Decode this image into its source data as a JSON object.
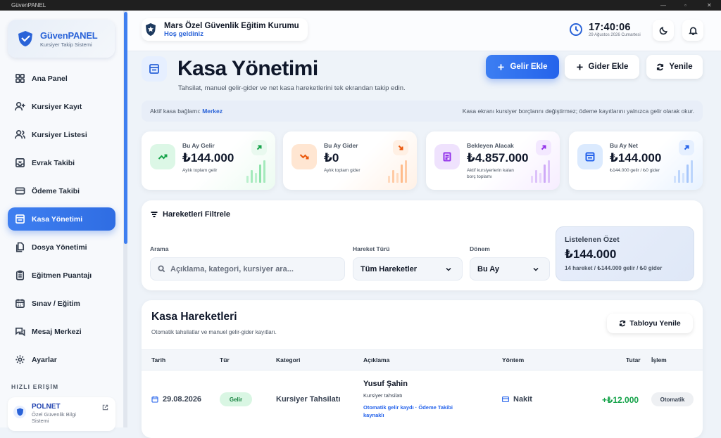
{
  "window": {
    "title": "GüvenPANEL"
  },
  "brand": {
    "name": "GüvenPANEL",
    "subtitle": "Kursiyer Takip Sistemi"
  },
  "sidebar": {
    "items": [
      {
        "label": "Ana Panel",
        "icon": "grid-icon"
      },
      {
        "label": "Kursiyer Kayıt",
        "icon": "user-plus-icon"
      },
      {
        "label": "Kursiyer Listesi",
        "icon": "users-icon"
      },
      {
        "label": "Evrak Takibi",
        "icon": "inbox-icon"
      },
      {
        "label": "Ödeme Takibi",
        "icon": "credit-card-icon"
      },
      {
        "label": "Kasa Yönetimi",
        "icon": "cash-register-icon",
        "active": true
      },
      {
        "label": "Dosya Yönetimi",
        "icon": "files-icon"
      },
      {
        "label": "Eğitmen Puantajı",
        "icon": "clipboard-icon"
      },
      {
        "label": "Sınav / Eğitim",
        "icon": "calendar-icon"
      },
      {
        "label": "Mesaj Merkezi",
        "icon": "messages-icon"
      },
      {
        "label": "Ayarlar",
        "icon": "gear-icon"
      }
    ],
    "quick_access_title": "HIZLI ERİŞİM",
    "quick_links": [
      {
        "name": "POLNET",
        "subtitle": "Özel Güvenlik Bilgi Sistemi"
      }
    ]
  },
  "topbar": {
    "org_name": "Mars Özel Güvenlik Eğitim Kurumu",
    "greeting": "Hoş geldiniz",
    "time": "17:40:06",
    "date": "29 Ağustos 2026 Cumartesi"
  },
  "page": {
    "title": "Kasa Yönetimi",
    "description": "Tahsilat, manuel gelir-gider ve net kasa hareketlerini tek ekrandan takip edin.",
    "buttons": {
      "add_income": "Gelir Ekle",
      "add_expense": "Gider Ekle",
      "refresh": "Yenile"
    }
  },
  "infobar": {
    "label": "Aktif kasa bağlamı:",
    "branch": "Merkez",
    "note": "Kasa ekranı kursiyer borçlarını değiştirmez; ödeme kayıtlarını yalnızca gelir olarak okur."
  },
  "stats": [
    {
      "label": "Bu Ay Gelir",
      "value": "₺144.000",
      "sub": "Aylık toplam gelir",
      "accent": "#22c55e"
    },
    {
      "label": "Bu Ay Gider",
      "value": "₺0",
      "sub": "Aylık toplam gider",
      "accent": "#f97316"
    },
    {
      "label": "Bekleyen Alacak",
      "value": "₺4.857.000",
      "sub": "Aktif kursiyerlerin kalan borç toplamı",
      "accent": "#a855f7"
    },
    {
      "label": "Bu Ay Net",
      "value": "₺144.000",
      "sub": "₺144.000 gelir / ₺0 gider",
      "accent": "#3b82f6"
    }
  ],
  "filter": {
    "title": "Hareketleri Filtrele",
    "search_label": "Arama",
    "search_placeholder": "Açıklama, kategori, kursiyer ara...",
    "type_label": "Hareket Türü",
    "type_value": "Tüm Hareketler",
    "period_label": "Dönem",
    "period_value": "Bu Ay",
    "summary_title": "Listelenen Özet",
    "summary_value": "₺144.000",
    "summary_sub": "14 hareket / ₺144.000 gelir / ₺0 gider"
  },
  "table": {
    "title": "Kasa Hareketleri",
    "subtitle": "Otomatik tahsilatlar ve manuel gelir-gider kayıtları.",
    "refresh_label": "Tabloyu Yenile",
    "columns": [
      "Tarih",
      "Tür",
      "Kategori",
      "Açıklama",
      "Yöntem",
      "Tutar",
      "İşlem"
    ],
    "rows": [
      {
        "date": "29.08.2026",
        "type": "Gelir",
        "category": "Kursiyer Tahsilatı",
        "name": "Yusuf Şahin",
        "detail": "Kursiyer tahsilatı",
        "link": "Otomatik gelir kaydı · Ödeme Takibi kaynaklı",
        "method": "Nakit",
        "amount": "+₺12.000",
        "action": "Otomatik"
      }
    ]
  }
}
